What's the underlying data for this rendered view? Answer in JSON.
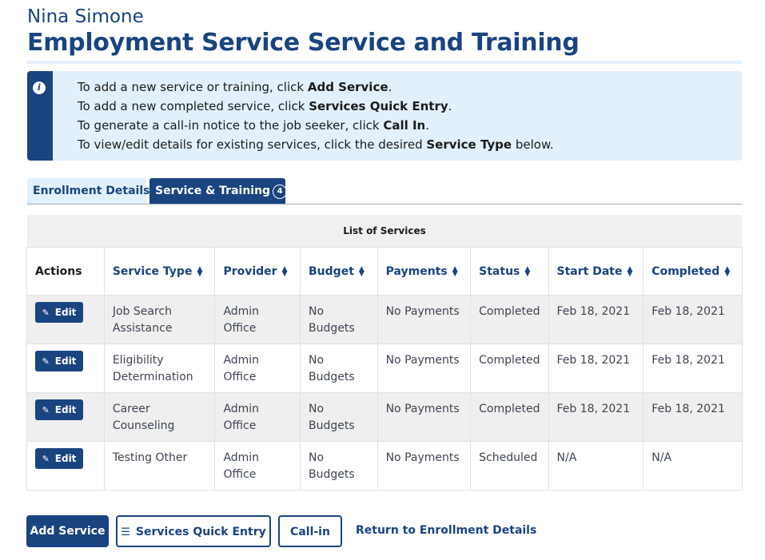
{
  "header": {
    "person_name": "Nina Simone",
    "title": "Employment Service Service and Training"
  },
  "alert": {
    "icon": "info-icon",
    "lines": [
      {
        "prefix": "To add a new service or training, click ",
        "bold": "Add Service",
        "suffix": "."
      },
      {
        "prefix": "To add a new completed service, click ",
        "bold": "Services Quick Entry",
        "suffix": "."
      },
      {
        "prefix": "To generate a call-in notice to the job seeker, click ",
        "bold": "Call In",
        "suffix": "."
      },
      {
        "prefix": "To view/edit details for existing services, click the desired ",
        "bold": "Service Type",
        "suffix": " below."
      }
    ]
  },
  "tabs": {
    "enrollment": "Enrollment Details",
    "service": "Service & Training",
    "service_count": "4"
  },
  "table": {
    "caption": "List of Services",
    "columns": [
      "Actions",
      "Service Type",
      "Provider",
      "Budget",
      "Payments",
      "Status",
      "Start Date",
      "Completed"
    ],
    "edit_label": "Edit",
    "rows": [
      {
        "service_type": "Job Search Assistance",
        "provider": "Admin Office",
        "budget": "No Budgets",
        "payments": "No Payments",
        "status": "Completed",
        "start_date": "Feb 18, 2021",
        "completed": "Feb 18, 2021"
      },
      {
        "service_type": "Eligibility Determination",
        "provider": "Admin Office",
        "budget": "No Budgets",
        "payments": "No Payments",
        "status": "Completed",
        "start_date": "Feb 18, 2021",
        "completed": "Feb 18, 2021"
      },
      {
        "service_type": "Career Counseling",
        "provider": "Admin Office",
        "budget": "No Budgets",
        "payments": "No Payments",
        "status": "Completed",
        "start_date": "Feb 18, 2021",
        "completed": "Feb 18, 2021"
      },
      {
        "service_type": "Testing Other",
        "provider": "Admin Office",
        "budget": "No Budgets",
        "payments": "No Payments",
        "status": "Scheduled",
        "start_date": "N/A",
        "completed": "N/A"
      }
    ]
  },
  "actions": {
    "add_service": "Add Service",
    "quick_entry": "Services Quick Entry",
    "call_in": "Call-in",
    "return_link": "Return to Enrollment Details"
  },
  "colors": {
    "primary": "#1a4480",
    "alert_bg": "#e1f0fb",
    "row_shade": "#efefef"
  }
}
